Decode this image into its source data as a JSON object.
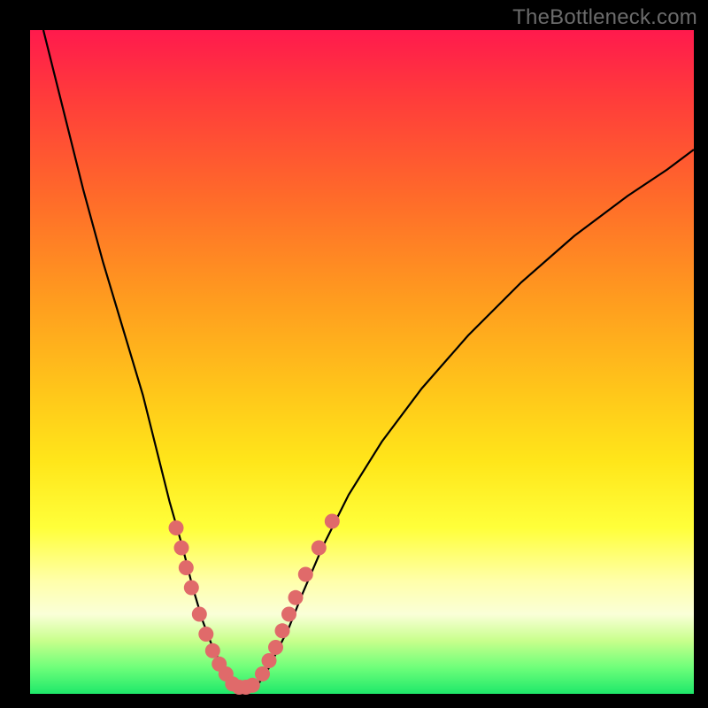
{
  "watermark": "TheBottleneck.com",
  "colors": {
    "gradient_top": "#ff1a4d",
    "gradient_bottom": "#1ee86a",
    "curve": "#000000",
    "dot": "#e06a6a",
    "frame": "#000000"
  },
  "chart_data": {
    "type": "line",
    "title": "",
    "xlabel": "",
    "ylabel": "",
    "xlim": [
      0,
      100
    ],
    "ylim": [
      0,
      100
    ],
    "grid": false,
    "legend": false,
    "series": [
      {
        "name": "left-branch",
        "x": [
          2,
          5,
          8,
          11,
          14,
          17,
          19,
          21,
          23,
          24.5,
          26,
          27.5,
          29,
          30,
          31
        ],
        "y": [
          100,
          88,
          76,
          65,
          55,
          45,
          37,
          29,
          22,
          16,
          11,
          7,
          4,
          2,
          1
        ]
      },
      {
        "name": "right-branch",
        "x": [
          34,
          35.5,
          37,
          39,
          41,
          44,
          48,
          53,
          59,
          66,
          74,
          82,
          90,
          96,
          100
        ],
        "y": [
          1,
          3,
          6,
          10,
          15,
          22,
          30,
          38,
          46,
          54,
          62,
          69,
          75,
          79,
          82
        ]
      }
    ],
    "trough_x_range": [
      31,
      34
    ],
    "dots_left_branch": [
      {
        "x": 22.0,
        "y": 25
      },
      {
        "x": 22.8,
        "y": 22
      },
      {
        "x": 23.5,
        "y": 19
      },
      {
        "x": 24.3,
        "y": 16
      },
      {
        "x": 25.5,
        "y": 12
      },
      {
        "x": 26.5,
        "y": 9
      },
      {
        "x": 27.5,
        "y": 6.5
      },
      {
        "x": 28.5,
        "y": 4.5
      },
      {
        "x": 29.5,
        "y": 3
      }
    ],
    "dots_trough": [
      {
        "x": 30.5,
        "y": 1.5
      },
      {
        "x": 31.5,
        "y": 1
      },
      {
        "x": 32.5,
        "y": 1
      },
      {
        "x": 33.5,
        "y": 1.3
      }
    ],
    "dots_right_branch": [
      {
        "x": 35.0,
        "y": 3
      },
      {
        "x": 36.0,
        "y": 5
      },
      {
        "x": 37.0,
        "y": 7
      },
      {
        "x": 38.0,
        "y": 9.5
      },
      {
        "x": 39.0,
        "y": 12
      },
      {
        "x": 40.0,
        "y": 14.5
      },
      {
        "x": 41.5,
        "y": 18
      },
      {
        "x": 43.5,
        "y": 22
      },
      {
        "x": 45.5,
        "y": 26
      }
    ]
  }
}
